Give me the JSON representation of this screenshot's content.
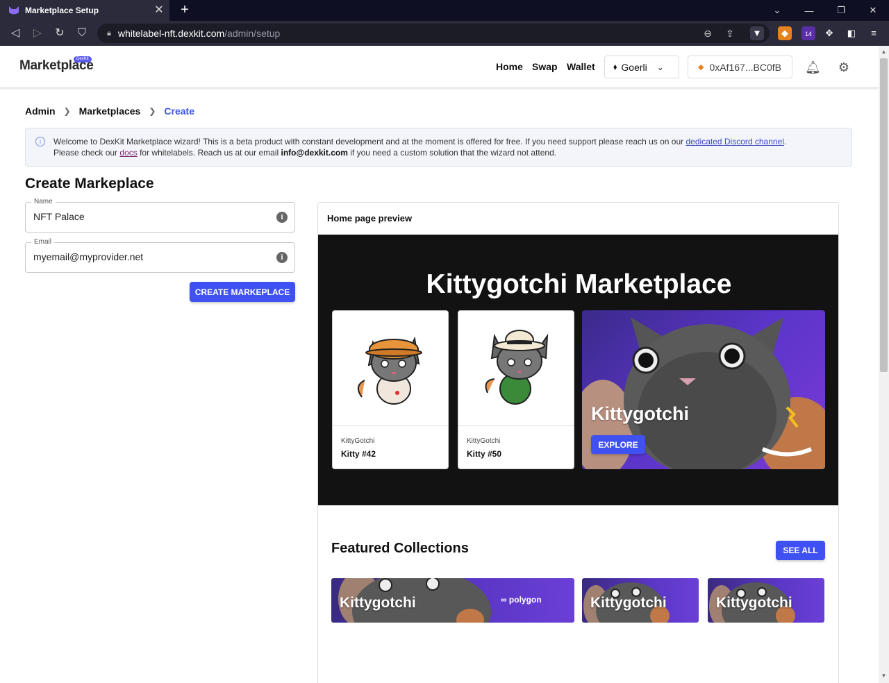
{
  "browser": {
    "tab_title": "Marketplace Setup",
    "url_host": "whitelabel-nft.dexkit.com",
    "url_path": "/admin/setup",
    "extension_badge": "14"
  },
  "header": {
    "logo": "Marketplace",
    "logo_badge": "DexKit",
    "nav": [
      "Home",
      "Swap",
      "Wallet"
    ],
    "network": "Goerli",
    "wallet_address": "0xAf167...BC0fB"
  },
  "breadcrumb": [
    "Admin",
    "Marketplaces",
    "Create"
  ],
  "alert": {
    "text1": "Welcome to DexKit Marketplace wizard! This is a beta product with constant development and at the moment is offered for free. If you need support please reach us on our ",
    "link_discord": "dedicated Discord channel",
    "text2": ".",
    "text3": "Please check our ",
    "link_docs": "docs",
    "text4": " for whitelabels. Reach us at our email ",
    "email": "info@dexkit.com",
    "text5": " if you need a custom solution that the wizard not attend."
  },
  "form": {
    "title": "Create Markeplace",
    "name_label": "Name",
    "name_value": "NFT Palace",
    "email_label": "Email",
    "email_value": "myemail@myprovider.net",
    "submit_label": "CREATE MARKEPLACE"
  },
  "preview": {
    "title": "Home page preview",
    "hero_title": "Kittygotchi Marketplace",
    "cards": [
      {
        "collection": "KittyGotchi",
        "name": "Kitty #42"
      },
      {
        "collection": "KittyGotchi",
        "name": "Kitty #50"
      }
    ],
    "banner_title": "Kittygotchi",
    "explore_label": "EXPLORE",
    "featured_title": "Featured Collections",
    "see_all_label": "SEE ALL",
    "collections": [
      {
        "title": "Kittygotchi",
        "network": "polygon"
      },
      {
        "title": "Kittygotchi"
      },
      {
        "title": "Kittygotchi"
      }
    ]
  }
}
